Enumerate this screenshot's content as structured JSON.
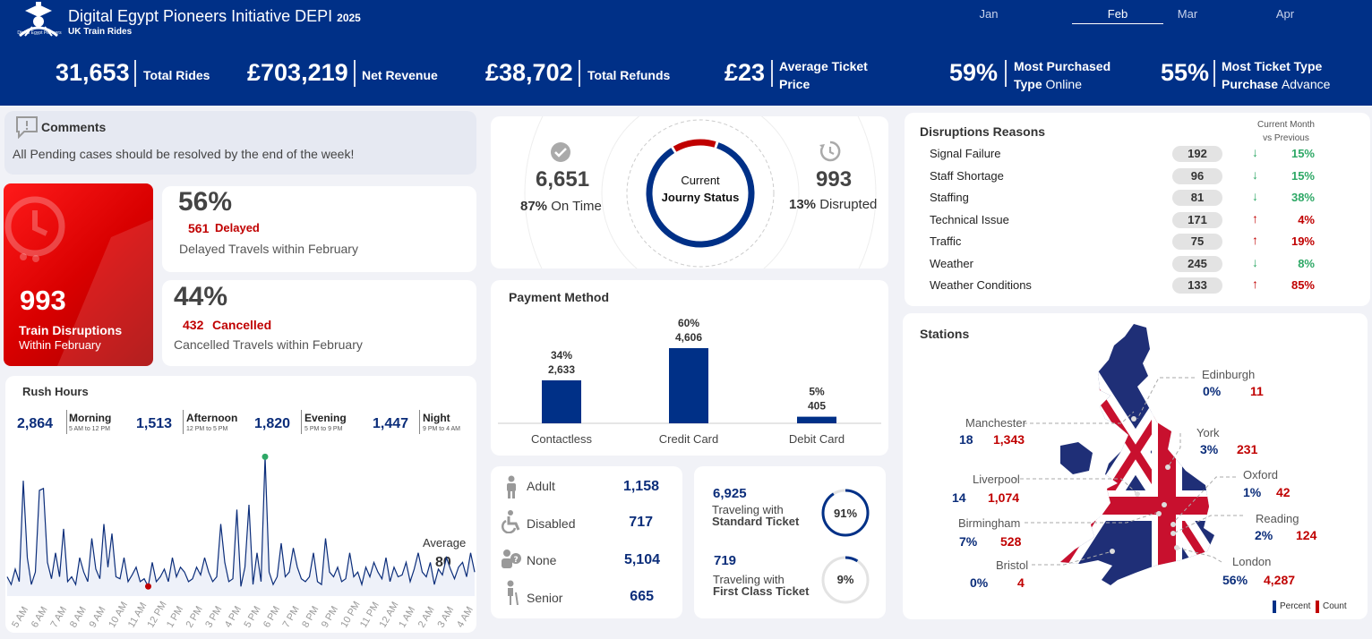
{
  "header": {
    "title": "Digital Egypt Pioneers Initiative DEPI",
    "year": "2025",
    "subtitle": "UK Train Rides",
    "logo_caption": "Digital Egypt Pioneers"
  },
  "months": [
    {
      "label": "Jan"
    },
    {
      "label": "Feb",
      "active": true
    },
    {
      "label": "Mar"
    },
    {
      "label": "Apr"
    }
  ],
  "kpis": [
    {
      "value": "31,653",
      "label1": "Total Rides",
      "label2": "",
      "label2b": ""
    },
    {
      "value": "£703,219",
      "label1": "Net Revenue",
      "label2": "",
      "label2b": ""
    },
    {
      "value": "£38,702",
      "label1": "Total Refunds",
      "label2": "",
      "label2b": ""
    },
    {
      "value": "£23",
      "label1": "Average Ticket",
      "label2": "Price",
      "label2b": ""
    },
    {
      "value": "59%",
      "label1": "Most Purchased",
      "label2": "Type",
      "label2b": "Online"
    },
    {
      "value": "55%",
      "label1": "Most Ticket Type",
      "label2": "Purchase",
      "label2b": "Advance"
    }
  ],
  "comments": {
    "title": "Comments",
    "text": "All Pending cases should be resolved by the end of the week!"
  },
  "disruption_card": {
    "value": "993",
    "label": "Train Disruptions",
    "sub": "Within February"
  },
  "delayed": {
    "percent": "56%",
    "count": "561",
    "count_label": "Delayed",
    "desc": "Delayed Travels within February"
  },
  "cancelled": {
    "percent": "44%",
    "count": "432",
    "count_label": "Cancelled",
    "desc": "Cancelled Travels within February"
  },
  "journey": {
    "on_time_value": "6,651",
    "on_time_pct": "87%",
    "on_time_label": "On Time",
    "center1": "Current",
    "center2": "Journy Status",
    "disrupted_value": "993",
    "disrupted_pct": "13%",
    "disrupted_label": "Disrupted",
    "disrupted_fraction": 0.13
  },
  "disruptions": {
    "title": "Disruptions Reasons",
    "compare_label1": "Current Month",
    "compare_label2": "vs Previous",
    "rows": [
      {
        "reason": "Signal Failure",
        "count": "192",
        "dir": "down",
        "change": "15%"
      },
      {
        "reason": "Staff Shortage",
        "count": "96",
        "dir": "down",
        "change": "15%"
      },
      {
        "reason": "Staffing",
        "count": "81",
        "dir": "down",
        "change": "38%"
      },
      {
        "reason": "Technical Issue",
        "count": "171",
        "dir": "up",
        "change": "4%"
      },
      {
        "reason": "Traffic",
        "count": "75",
        "dir": "up",
        "change": "19%"
      },
      {
        "reason": "Weather",
        "count": "245",
        "dir": "down",
        "change": "8%"
      },
      {
        "reason": "Weather Conditions",
        "count": "133",
        "dir": "up",
        "change": "85%"
      }
    ]
  },
  "payment": {
    "title": "Payment Method"
  },
  "rush": {
    "title": "Rush Hours",
    "average_label": "Average",
    "average_value": "80",
    "periods": [
      {
        "value": "2,864",
        "name": "Morning",
        "range": "5 AM to 12 PM"
      },
      {
        "value": "1,513",
        "name": "Afternoon",
        "range": "12 PM to 5 PM"
      },
      {
        "value": "1,820",
        "name": "Evening",
        "range": "5 PM to 9 PM"
      },
      {
        "value": "1,447",
        "name": "Night",
        "range": "9 PM to 4 AM"
      }
    ]
  },
  "passengers": [
    {
      "label": "Adult",
      "value": "1,158",
      "icon": "person-icon"
    },
    {
      "label": "Disabled",
      "value": "717",
      "icon": "wheelchair-icon"
    },
    {
      "label": "None",
      "value": "5,104",
      "icon": "unknown-person-icon"
    },
    {
      "label": "Senior",
      "value": "665",
      "icon": "senior-icon"
    }
  ],
  "tickets": [
    {
      "value": "6,925",
      "line1": "Traveling with",
      "line2": "Standard Ticket",
      "pct": "91%",
      "fraction": 0.91
    },
    {
      "value": "719",
      "line1": "Traveling with",
      "line2": "First Class Ticket",
      "pct": "9%",
      "fraction": 0.09
    }
  ],
  "stations": {
    "title": "Stations",
    "legend_percent": "Percent",
    "legend_count": "Count",
    "items": [
      {
        "name": "Edinburgh",
        "pct": "0%",
        "count": "11"
      },
      {
        "name": "Manchester",
        "pct": "18",
        "count": "1,343"
      },
      {
        "name": "York",
        "pct": "3%",
        "count": "231"
      },
      {
        "name": "Liverpool",
        "pct": "14",
        "count": "1,074"
      },
      {
        "name": "Oxford",
        "pct": "1%",
        "count": "42"
      },
      {
        "name": "Birmingham",
        "pct": "7%",
        "count": "528"
      },
      {
        "name": "Reading",
        "pct": "2%",
        "count": "124"
      },
      {
        "name": "Bristol",
        "pct": "0%",
        "count": "4"
      },
      {
        "name": "London",
        "pct": "56%",
        "count": "4,287"
      }
    ]
  },
  "colors": {
    "navy": "#003087",
    "red": "#c00000",
    "green": "#2ea866"
  },
  "chart_data": [
    {
      "type": "bar",
      "title": "Payment Method",
      "categories": [
        "Contactless",
        "Credit Card",
        "Debit Card"
      ],
      "values": [
        2633,
        4606,
        405
      ],
      "percent_labels": [
        "34%",
        "60%",
        "5%"
      ],
      "value_labels": [
        "2,633",
        "4,606",
        "405"
      ]
    },
    {
      "type": "line",
      "title": "Rush Hours",
      "x": [
        "5 AM",
        "6 AM",
        "7 AM",
        "8 AM",
        "9 AM",
        "10 AM",
        "11 AM",
        "12 PM",
        "1 PM",
        "2 PM",
        "3 PM",
        "4 PM",
        "5 PM",
        "6 PM",
        "7 PM",
        "8 PM",
        "9 PM",
        "10 PM",
        "11 PM",
        "12 AM",
        "1 AM",
        "2 AM",
        "3 AM",
        "4 AM"
      ],
      "values": [
        20,
        12,
        28,
        15,
        120,
        40,
        12,
        25,
        110,
        112,
        35,
        18,
        45,
        20,
        70,
        15,
        20,
        12,
        40,
        25,
        15,
        60,
        28,
        18,
        75,
        30,
        65,
        20,
        18,
        40,
        15,
        22,
        30,
        15,
        18,
        10,
        35,
        15,
        20,
        28,
        15,
        40,
        20,
        30,
        25,
        15,
        18,
        30,
        22,
        40,
        25,
        15,
        20,
        75,
        35,
        15,
        18,
        90,
        10,
        30,
        95,
        12,
        45,
        15,
        145,
        25,
        12,
        20,
        55,
        20,
        25,
        50,
        30,
        18,
        15,
        20,
        45,
        15,
        12,
        60,
        25,
        20,
        30,
        15,
        18,
        45,
        20,
        25,
        12,
        30,
        20,
        35,
        25,
        18,
        40,
        15,
        30,
        20,
        22,
        35,
        15,
        28,
        45,
        25,
        20,
        35,
        12,
        28,
        22,
        40,
        28,
        18,
        30,
        35,
        20,
        45,
        25
      ],
      "average": 80,
      "max_marker": "green",
      "min_marker": "red"
    }
  ]
}
